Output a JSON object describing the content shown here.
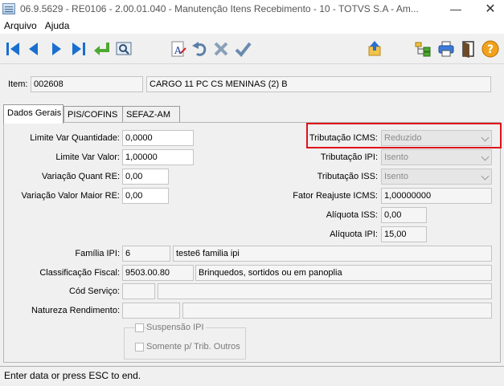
{
  "window": {
    "title": "06.9.5629 - RE0106 - 2.00.01.040 - Manutenção Itens Recebimento - 10 - TOTVS S.A - Am..."
  },
  "menu": [
    "Arquivo",
    "Ajuda"
  ],
  "toolbar": {
    "icons": [
      "first-record-icon",
      "previous-record-icon",
      "next-record-icon",
      "last-record-icon",
      "goto-icon",
      "search-icon",
      "font-icon",
      "undo-icon",
      "cancel-icon",
      "confirm-icon",
      "folder-up-icon",
      "tree-icon",
      "print-icon",
      "exit-icon",
      "help-icon"
    ]
  },
  "item": {
    "label": "Item:",
    "code": "002608",
    "description": "CARGO 11 PC CS MENINAS (2) B"
  },
  "tabs": [
    "Dados Gerais",
    "PIS/COFINS",
    "SEFAZ-AM"
  ],
  "left_fields": [
    {
      "label": "Limite Var Quantidade:",
      "value": "0,0000"
    },
    {
      "label": "Limite Var Valor:",
      "value": "1,00000"
    },
    {
      "label": "Variação Quant RE:",
      "value": "0,00"
    },
    {
      "label": "Variação Valor Maior RE:",
      "value": "0,00"
    }
  ],
  "right_fields": {
    "trib_icms": {
      "label": "Tributação ICMS:",
      "value": "Reduzido"
    },
    "trib_ipi": {
      "label": "Tributação IPI:",
      "value": "Isento"
    },
    "trib_iss": {
      "label": "Tributação ISS:",
      "value": "Isento"
    },
    "fator": {
      "label": "Fator Reajuste ICMS:",
      "value": "1,00000000"
    },
    "aliq_iss": {
      "label": "Alíquota ISS:",
      "value": "0,00"
    },
    "aliq_ipi": {
      "label": "Alíquota IPI:",
      "value": "15,00"
    }
  },
  "bottom_fields": {
    "familia": {
      "label": "Família IPI:",
      "code": "6",
      "desc": "teste6 familia ipi"
    },
    "classificacao": {
      "label": "Classificação Fiscal:",
      "code": "9503.00.80",
      "desc": "Brinquedos, sortidos ou em panoplia"
    },
    "cod_servico": {
      "label": "Cód Serviço:",
      "code": "",
      "desc": ""
    },
    "natureza": {
      "label": "Natureza Rendimento:",
      "code": "",
      "desc": ""
    }
  },
  "checkboxes": [
    {
      "label": "Suspensão IPI",
      "checked": false
    },
    {
      "label": "Somente p/ Trib. Outros",
      "checked": false
    }
  ],
  "status": {
    "text": "Enter data or press ESC to end."
  },
  "colors": {
    "highlight": "#e0101a",
    "nav_blue": "#1a6fd0",
    "green": "#4ea832"
  }
}
